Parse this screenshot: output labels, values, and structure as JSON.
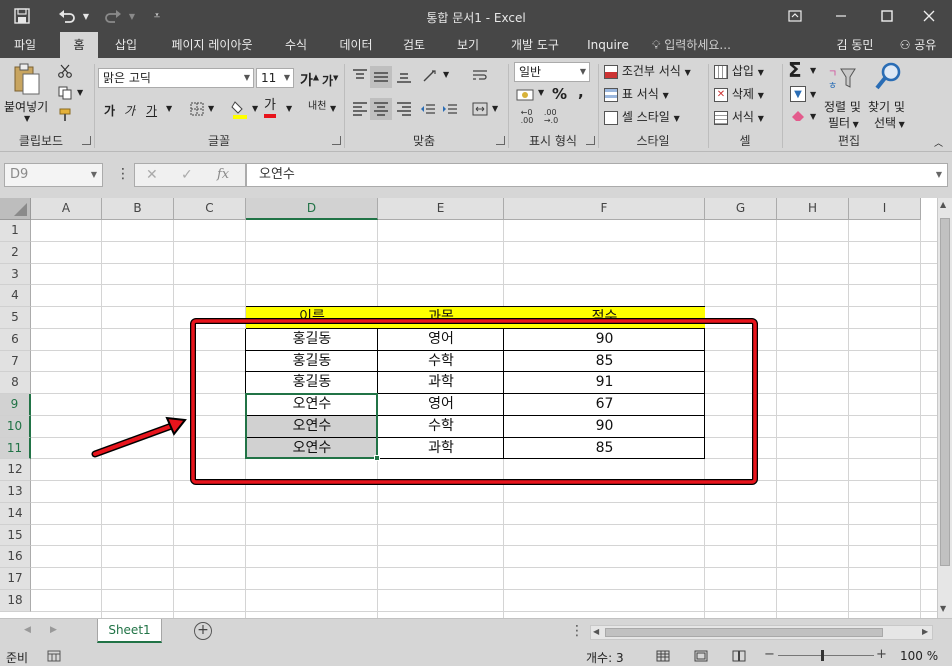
{
  "window": {
    "title": "통합 문서1 - Excel"
  },
  "ribbon_tabs": [
    {
      "label": "파일"
    },
    {
      "label": "홈"
    },
    {
      "label": "삽입"
    },
    {
      "label": "페이지 레이아웃"
    },
    {
      "label": "수식"
    },
    {
      "label": "데이터"
    },
    {
      "label": "검토"
    },
    {
      "label": "보기"
    },
    {
      "label": "개발 도구"
    },
    {
      "label": "Inquire"
    }
  ],
  "tell_me": "입력하세요...",
  "user_name": "김 동민",
  "share_label": "공유",
  "clipboard": {
    "paste_label": "붙여넣기",
    "group_label": "클립보드"
  },
  "font": {
    "name": "맑은 고딕",
    "size": "11",
    "group_label": "글꼴",
    "bold": "가",
    "italic": "가",
    "underline": "가",
    "grow": "가",
    "shrink": "가",
    "font_color": "가",
    "phonetic": "내천"
  },
  "alignment": {
    "group_label": "맞춤"
  },
  "number": {
    "format": "일반",
    "group_label": "표시 형식",
    "percent": "%",
    "comma": ","
  },
  "styles": {
    "conditional": "조건부 서식",
    "table": "표 서식",
    "cell_styles": "셀 스타일",
    "group_label": "스타일"
  },
  "cells": {
    "insert": "삽입",
    "delete": "삭제",
    "format": "서식",
    "group_label": "셀"
  },
  "editing": {
    "sort_filter_line1": "정렬 및",
    "sort_filter_line2": "필터",
    "find_line1": "찾기 및",
    "find_line2": "선택",
    "group_label": "편집"
  },
  "formula_bar": {
    "name_box": "D9",
    "content": "오연수"
  },
  "columns": [
    "A",
    "B",
    "C",
    "D",
    "E",
    "F",
    "G",
    "H",
    "I"
  ],
  "rows": [
    "1",
    "2",
    "3",
    "4",
    "5",
    "6",
    "7",
    "8",
    "9",
    "10",
    "11",
    "12",
    "13",
    "14",
    "15",
    "16",
    "17",
    "18"
  ],
  "table": {
    "headers": [
      "이름",
      "과목",
      "점수"
    ],
    "rows": [
      [
        "홍길동",
        "영어",
        "90"
      ],
      [
        "홍길동",
        "수학",
        "85"
      ],
      [
        "홍길동",
        "과학",
        "91"
      ],
      [
        "오연수",
        "영어",
        "67"
      ],
      [
        "오연수",
        "수학",
        "90"
      ],
      [
        "오연수",
        "과학",
        "85"
      ]
    ]
  },
  "sheet_tab": "Sheet1",
  "status": {
    "ready": "준비",
    "count": "개수: 3",
    "zoom": "100 %"
  },
  "colors": {
    "accent": "#217346",
    "header_fill": "#ffff00",
    "highlight_red": "#e8141c"
  }
}
